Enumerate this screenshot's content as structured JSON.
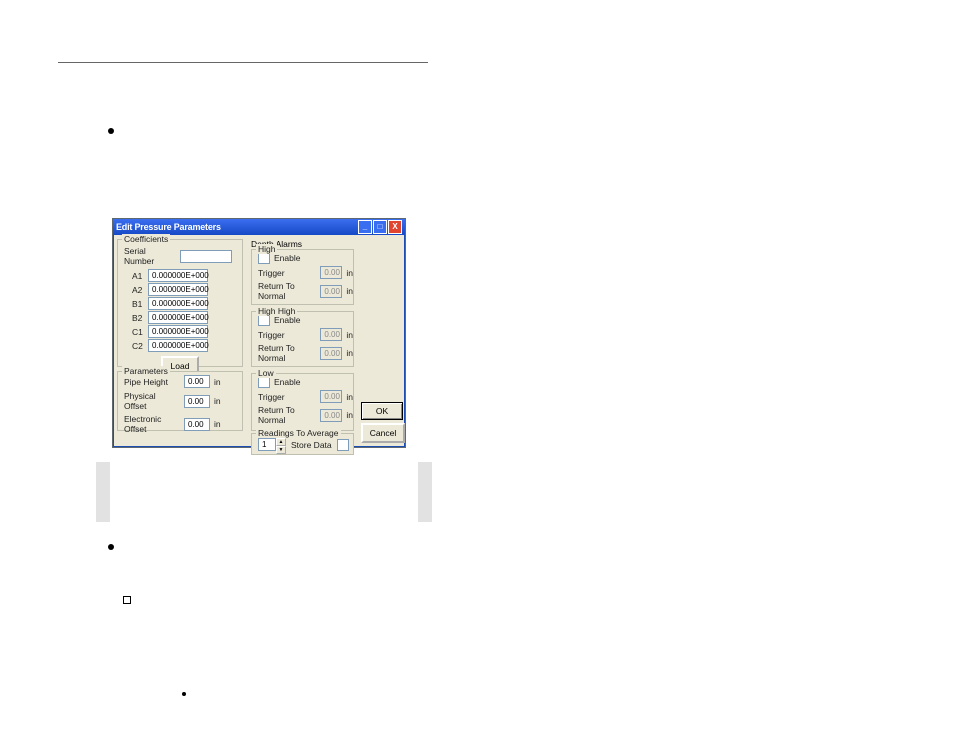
{
  "window": {
    "title": "Edit Pressure Parameters",
    "min": "_",
    "max": "□",
    "close": "X"
  },
  "coeff": {
    "legend": "Coefficients",
    "serial_label": "Serial Number",
    "serial_value": "",
    "rows": {
      "A1": "0.000000E+000",
      "A2": "0.000000E+000",
      "B1": "0.000000E+000",
      "B2": "0.000000E+000",
      "C1": "0.000000E+000",
      "C2": "0.000000E+000"
    },
    "load": "Load"
  },
  "params": {
    "legend": "Parameters",
    "pipe_height_label": "Pipe Height",
    "pipe_height_value": "0.00",
    "physical_offset_label": "Physical Offset",
    "physical_offset_value": "0.00",
    "electronic_offset_label": "Electronic Offset",
    "electronic_offset_value": "0.00",
    "unit": "in"
  },
  "alarms": {
    "legend": "Depth Alarms",
    "enable": "Enable",
    "trigger": "Trigger",
    "return": "Return To Normal",
    "unit": "in",
    "trigger_value": "0.00",
    "return_value": "0.00",
    "high": "High",
    "highhigh": "High High",
    "low": "Low"
  },
  "readings": {
    "legend": "Readings To Average",
    "value": "1",
    "store": "Store Data"
  },
  "buttons": {
    "ok": "OK",
    "cancel": "Cancel"
  }
}
